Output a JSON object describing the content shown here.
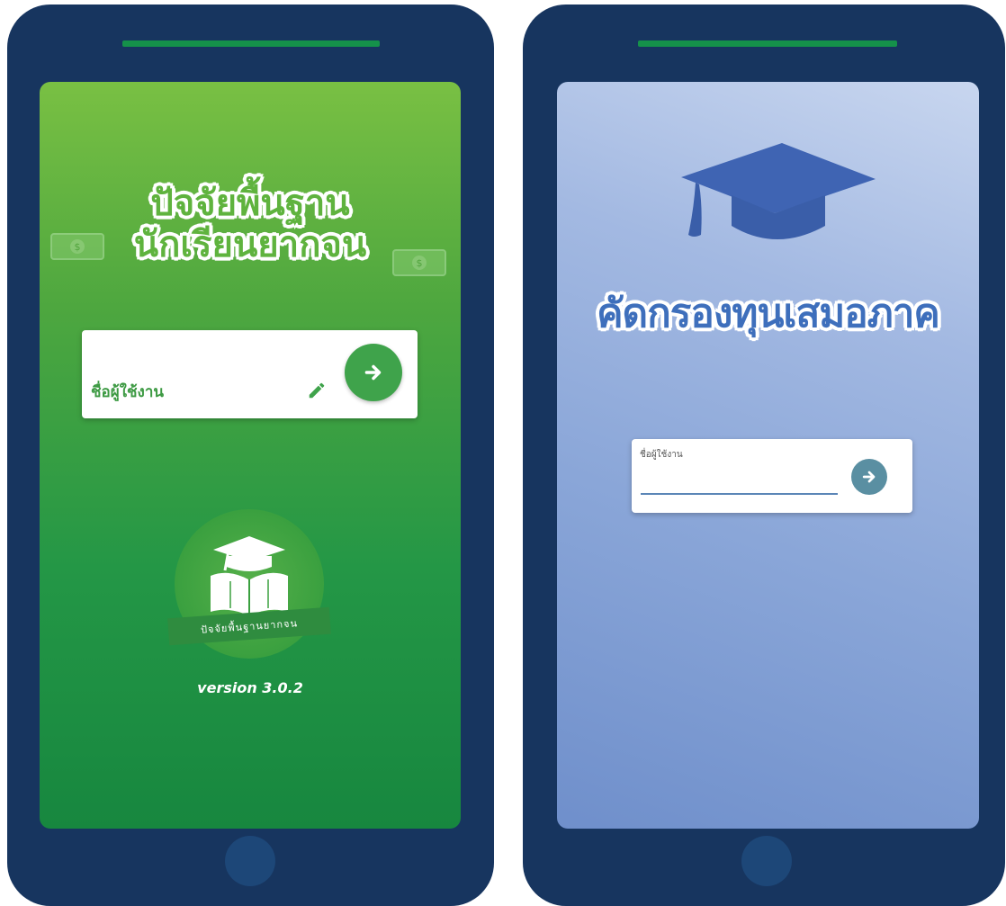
{
  "left_app": {
    "title_line1": "ปัจจัยพื้นฐาน",
    "title_line2": "นักเรียนยากจน",
    "username_label": "ชื่อผู้ใช้งาน",
    "logo_ribbon_text": "ปัจจัยพื้นฐานยากจน",
    "version": "version 3.0.2",
    "accent_color": "#3fa34b"
  },
  "right_app": {
    "title": "คัดกรองทุนเสมอภาค",
    "username_label": "ชื่อผู้ใช้งาน",
    "accent_color": "#3e6fbc"
  },
  "icons": {
    "submit": "arrow-right-icon",
    "edit": "pencil-icon",
    "logo": "graduation-cap-book-icon",
    "cap": "graduation-cap-icon"
  }
}
